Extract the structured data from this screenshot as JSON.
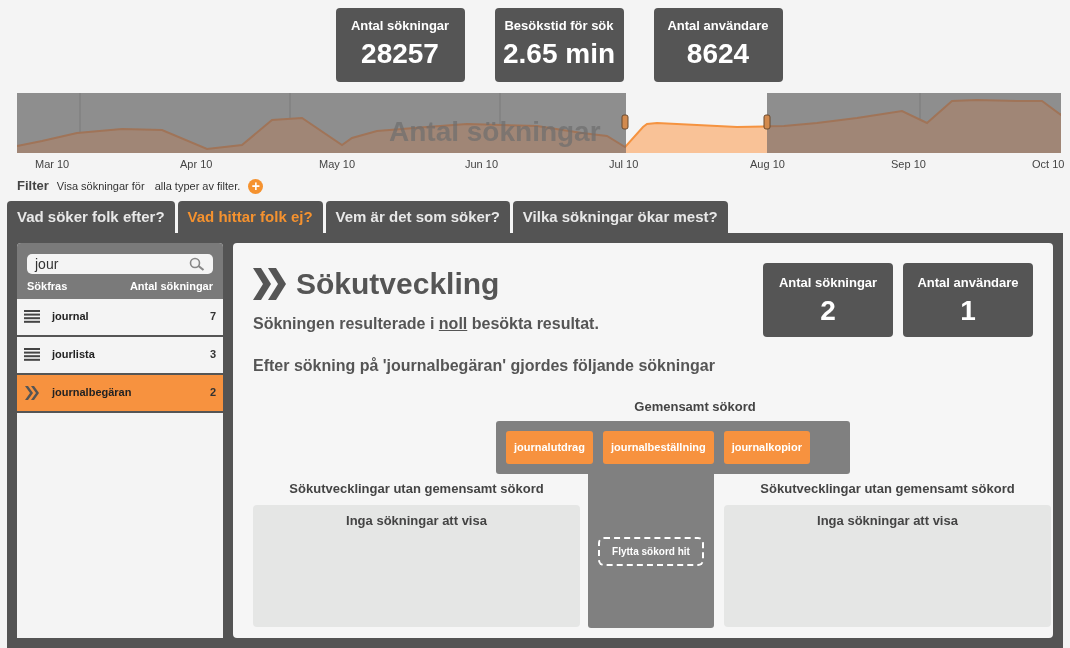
{
  "stats": [
    {
      "label": "Antal sökningar",
      "value": "28257"
    },
    {
      "label": "Besökstid för sök",
      "value": "2.65 min"
    },
    {
      "label": "Antal användare",
      "value": "8624"
    }
  ],
  "timeline": {
    "title": "Antal sökningar",
    "labels": [
      "Mar 10",
      "Apr 10",
      "May 10",
      "Jun 10",
      "Jul 10",
      "Aug 10",
      "Sep 10",
      "Oct 10"
    ]
  },
  "filter": {
    "label": "Filter",
    "prefix": "Visa sökningar för",
    "value": "alla typer av filter.",
    "add_icon": "+"
  },
  "tabs": [
    {
      "label": "Vad söker folk efter?",
      "selected": false
    },
    {
      "label": "Vad hittar folk ej?",
      "selected": true
    },
    {
      "label": "Vem är det som söker?",
      "selected": false
    },
    {
      "label": "Vilka sökningar ökar mest?",
      "selected": false
    }
  ],
  "sidebar": {
    "search": {
      "value": "jour"
    },
    "columns": [
      "Sökfras",
      "Antal sökningar"
    ],
    "items": [
      {
        "phrase": "journal",
        "count": "7",
        "selected": false
      },
      {
        "phrase": "jourlista",
        "count": "3",
        "selected": false
      },
      {
        "phrase": "journalbegäran",
        "count": "2",
        "selected": true
      }
    ]
  },
  "detail": {
    "title": "Sökutveckling",
    "summary": [
      {
        "text": "Sökningen resulterade i ",
        "underlined": false
      },
      {
        "text": "noll",
        "underlined": true
      },
      {
        "text": " besökta resultat.",
        "underlined": false
      }
    ],
    "follow_up": "Efter sökning på 'journalbegäran' gjordes följande sökningar",
    "stats": [
      {
        "label": "Antal sökningar",
        "value": "2"
      },
      {
        "label": "Antal användare",
        "value": "1"
      }
    ],
    "common_heading": "Gemensamt sökord",
    "common_terms": [
      "journalutdrag",
      "journalbeställning",
      "journalkopior"
    ],
    "drop_hint": "Flytta sökord hit",
    "side_panels": [
      {
        "heading": "Sökutvecklingar utan gemensamt sökord",
        "empty": "Inga sökningar att visa"
      },
      {
        "heading": "Sökutvecklingar utan gemensamt sökord",
        "empty": "Inga sökningar att visa"
      }
    ]
  }
}
